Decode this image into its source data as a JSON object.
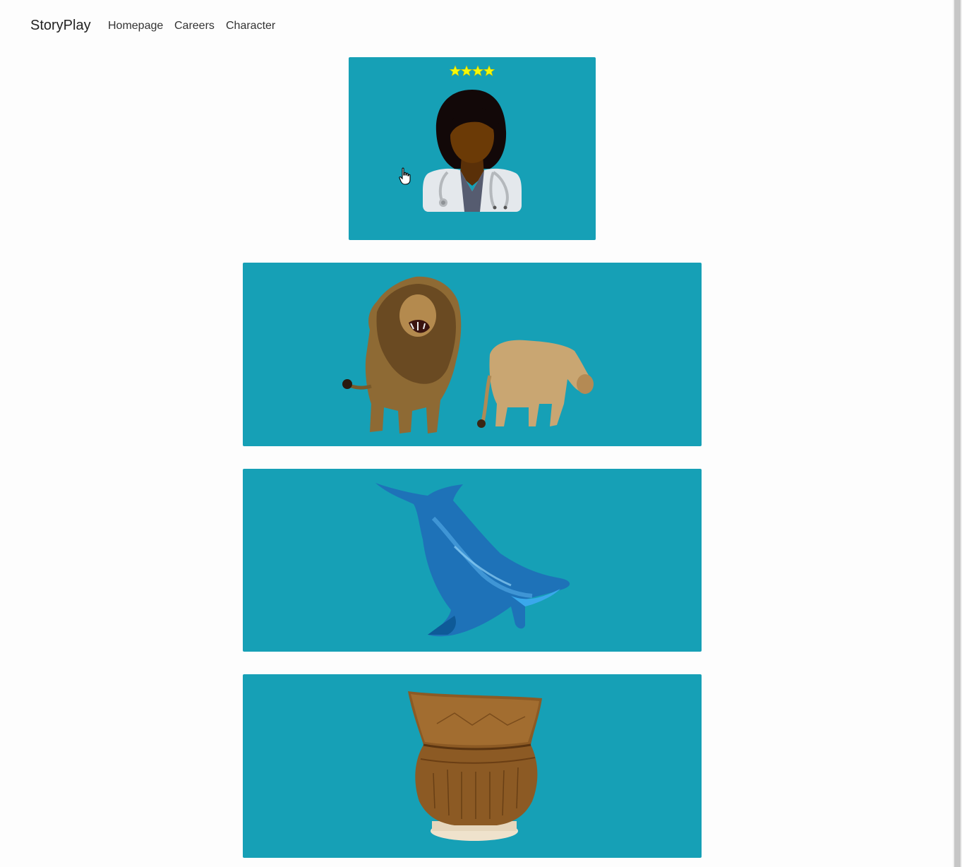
{
  "nav": {
    "brand": "StoryPlay",
    "links": [
      {
        "label": "Homepage"
      },
      {
        "label": "Careers"
      },
      {
        "label": "Character"
      }
    ]
  },
  "cards": [
    {
      "id": "doctor",
      "icon": "doctor-icon",
      "rating": 4,
      "rating_max": 4
    },
    {
      "id": "lions",
      "icon": "lion-image"
    },
    {
      "id": "dolphin",
      "icon": "dolphin-image"
    },
    {
      "id": "pottery",
      "icon": "pottery-image"
    }
  ],
  "colors": {
    "card_bg": "#16a0b6",
    "star": "#f4f90a",
    "page_bg": "#fdfdfd"
  }
}
